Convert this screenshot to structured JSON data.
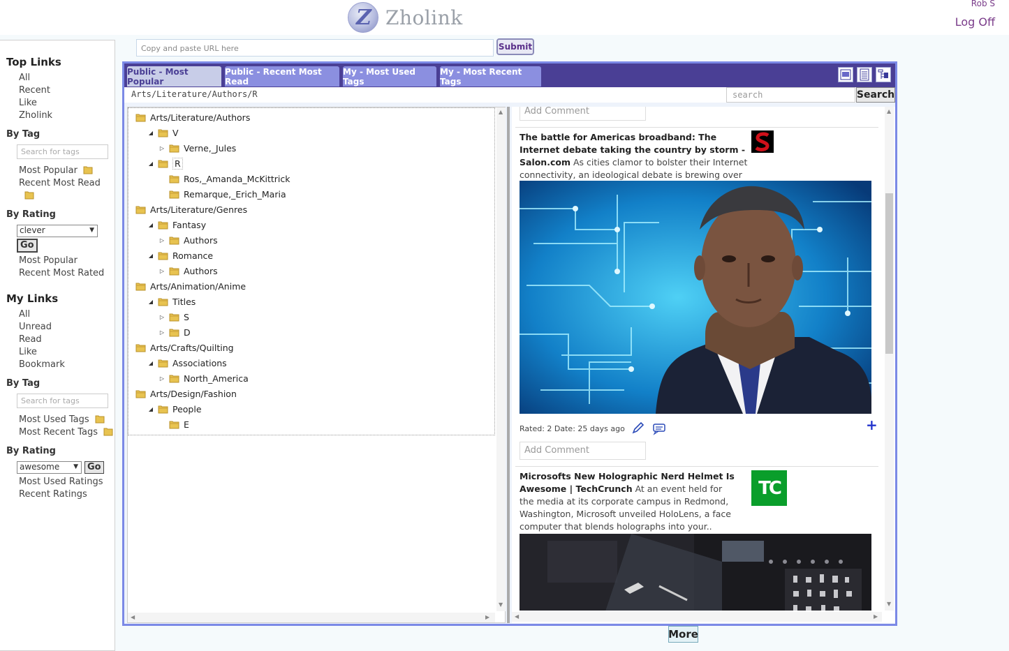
{
  "header": {
    "brand": "Zholink",
    "logo_letter": "Z",
    "user_name": "Rob S",
    "logoff_label": "Log Off"
  },
  "url_bar": {
    "placeholder": "Copy and paste URL here",
    "submit_label": "Submit"
  },
  "sidebar": {
    "top_links": {
      "title": "Top Links",
      "items": [
        "All",
        "Recent",
        "Like",
        "Zholink"
      ]
    },
    "top_by_tag": {
      "title": "By Tag",
      "search_placeholder": "Search for tags",
      "items": [
        "Most Popular",
        "Recent Most Read"
      ]
    },
    "top_by_rating": {
      "title": "By Rating",
      "selected": "clever",
      "go_label": "Go",
      "items": [
        "Most Popular",
        "Recent Most Rated"
      ]
    },
    "my_links": {
      "title": "My Links",
      "items": [
        "All",
        "Unread",
        "Read",
        "Like",
        "Bookmark"
      ]
    },
    "my_by_tag": {
      "title": "By Tag",
      "search_placeholder": "Search for tags",
      "items": [
        "Most Used Tags",
        "Most Recent Tags"
      ]
    },
    "my_by_rating": {
      "title": "By Rating",
      "selected": "awesome",
      "go_label": "Go",
      "items": [
        "Most Used Ratings",
        "Recent Ratings"
      ]
    }
  },
  "tabs": [
    {
      "label": "Public - Most Popular",
      "active": true
    },
    {
      "label": "Public - Recent Most Read",
      "active": false
    },
    {
      "label": "My - Most Used Tags",
      "active": false
    },
    {
      "label": "My - Most Recent Tags",
      "active": false
    }
  ],
  "path": "Arts/Literature/Authors/R",
  "search": {
    "placeholder": "search",
    "button_label": "Search"
  },
  "tree": [
    {
      "label": "Arts/Literature/Authors",
      "depth": 0,
      "toggle": ""
    },
    {
      "label": "V",
      "depth": 1,
      "toggle": "open"
    },
    {
      "label": "Verne,_Jules",
      "depth": 2,
      "toggle": "closed"
    },
    {
      "label": "R",
      "depth": 1,
      "toggle": "open",
      "selected": true
    },
    {
      "label": "Ros,_Amanda_McKittrick",
      "depth": 2,
      "toggle": ""
    },
    {
      "label": "Remarque,_Erich_Maria",
      "depth": 2,
      "toggle": ""
    },
    {
      "label": "Arts/Literature/Genres",
      "depth": 0,
      "toggle": ""
    },
    {
      "label": "Fantasy",
      "depth": 1,
      "toggle": "open"
    },
    {
      "label": "Authors",
      "depth": 2,
      "toggle": "closed"
    },
    {
      "label": "Romance",
      "depth": 1,
      "toggle": "open"
    },
    {
      "label": "Authors",
      "depth": 2,
      "toggle": "closed"
    },
    {
      "label": "Arts/Animation/Anime",
      "depth": 0,
      "toggle": ""
    },
    {
      "label": "Titles",
      "depth": 1,
      "toggle": "open"
    },
    {
      "label": "S",
      "depth": 2,
      "toggle": "closed"
    },
    {
      "label": "D",
      "depth": 2,
      "toggle": "closed"
    },
    {
      "label": "Arts/Crafts/Quilting",
      "depth": 0,
      "toggle": ""
    },
    {
      "label": "Associations",
      "depth": 1,
      "toggle": "open"
    },
    {
      "label": "North_America",
      "depth": 2,
      "toggle": "closed"
    },
    {
      "label": "Arts/Design/Fashion",
      "depth": 0,
      "toggle": ""
    },
    {
      "label": "People",
      "depth": 1,
      "toggle": "open"
    },
    {
      "label": "E",
      "depth": 2,
      "toggle": ""
    }
  ],
  "feed": {
    "comment_placeholder": "Add Comment",
    "articles": [
      {
        "title": "The battle for Americas broadband: The Internet debate taking the country by storm - Salon.com",
        "snippet": "As cities clamor to bolster their Internet connectivity, an ideological debate is brewing over how to get it done",
        "source_icon": "salon-icon",
        "meta": "Rated: 2 Date: 25 days ago"
      },
      {
        "title": "Microsofts New Holographic Nerd Helmet Is Awesome | TechCrunch",
        "snippet": "At an event held for the media at its corporate campus in Redmond, Washington, Microsoft unveiled HoloLens, a face computer that blends holographs into your..",
        "source_icon": "techcrunch-icon",
        "source_text": "TC"
      }
    ]
  },
  "more_label": "More",
  "colors": {
    "tab_bar": "#4a3f95",
    "tab": "#8b8fe0",
    "panel_border": "#7b89e6",
    "link_accent": "#7a3c8a",
    "techcrunch": "#0a9e2b",
    "salon": "#d0101a"
  }
}
